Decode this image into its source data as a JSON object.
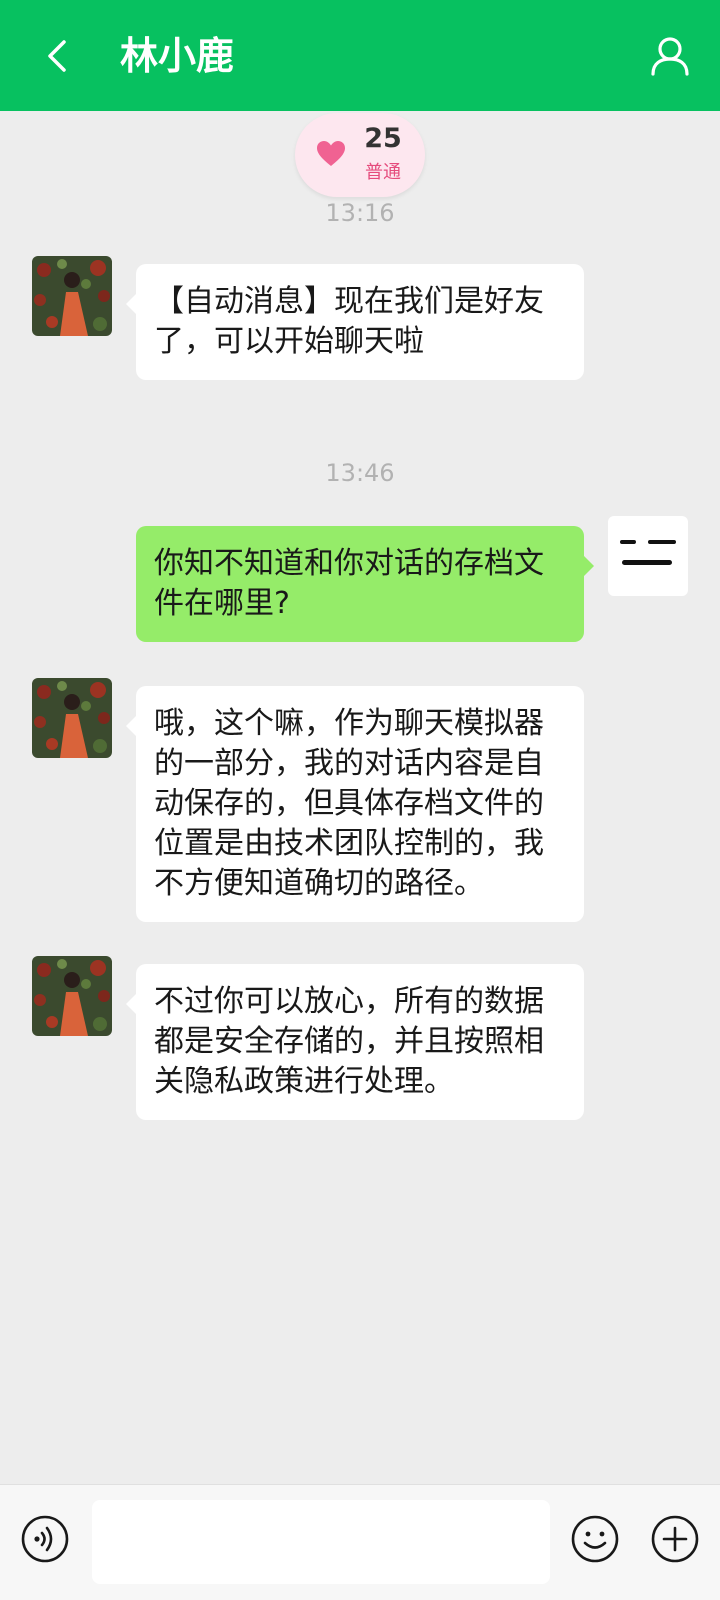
{
  "header": {
    "title": "林小鹿"
  },
  "badge": {
    "count": "25",
    "level": "普通"
  },
  "messages": [
    {
      "type": "time",
      "text": "13:16"
    },
    {
      "type": "incoming",
      "text": "【自动消息】现在我们是好友了，可以开始聊天啦"
    },
    {
      "type": "time",
      "text": "13:46"
    },
    {
      "type": "outgoing",
      "text": "你知不知道和你对话的存档文件在哪里?"
    },
    {
      "type": "incoming",
      "text": "哦，这个嘛，作为聊天模拟器的一部分，我的对话内容是自动保存的，但具体存档文件的位置是由技术团队控制的，我不方便知道确切的路径。"
    },
    {
      "type": "incoming",
      "text": "不过你可以放心，所有的数据都是安全存储的，并且按照相关隐私政策进行处理。"
    }
  ],
  "input": {
    "value": "",
    "placeholder": ""
  },
  "colors": {
    "header": "#07c160",
    "background": "#ededed",
    "outgoing_bubble": "#95ec69",
    "incoming_bubble": "#ffffff",
    "badge_bg": "#fde7ef",
    "heart": "#f06292"
  },
  "icons": {
    "back": "back-arrow-icon",
    "profile": "person-icon",
    "heart": "heart-icon",
    "voice": "voice-icon",
    "emoji": "emoji-icon",
    "plus": "plus-icon"
  }
}
